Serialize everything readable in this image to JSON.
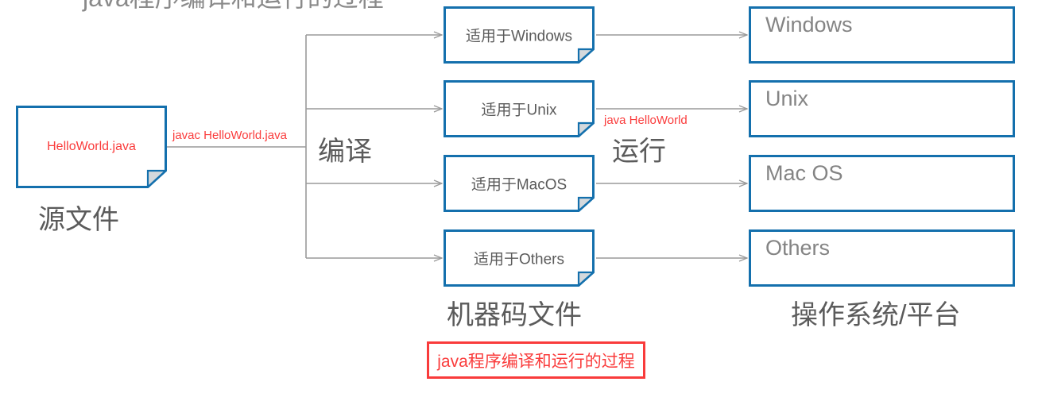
{
  "diagram": {
    "top_clipped_heading": "java程序编译和运行的过程",
    "title_box": {
      "text": "java程序编译和运行的过程"
    },
    "colors": {
      "node_border_blue": "#1470ad",
      "accent_red": "#fa3c3c",
      "title_border_red": "#f93b3b",
      "connector_gray": "#9a9a9a",
      "caption_gray": "#5b5b5b",
      "os_text_gray": "#848484",
      "fold_fill_gray": "#d5d9dc"
    },
    "source": {
      "node_label": "HelloWorld.java",
      "caption": "源文件"
    },
    "compile": {
      "stage_label": "编译",
      "command_label": "javac HelloWorld.java"
    },
    "run": {
      "stage_label": "运行",
      "command_label": "java HelloWorld"
    },
    "machine_code": {
      "caption": "机器码文件",
      "nodes": [
        {
          "label": "适用于Windows"
        },
        {
          "label": "适用于Unix"
        },
        {
          "label": "适用于MacOS"
        },
        {
          "label": "适用于Others"
        }
      ]
    },
    "platform": {
      "caption": "操作系统/平台",
      "nodes": [
        {
          "label": "Windows"
        },
        {
          "label": "Unix"
        },
        {
          "label": "Mac OS"
        },
        {
          "label": "Others"
        }
      ]
    }
  }
}
